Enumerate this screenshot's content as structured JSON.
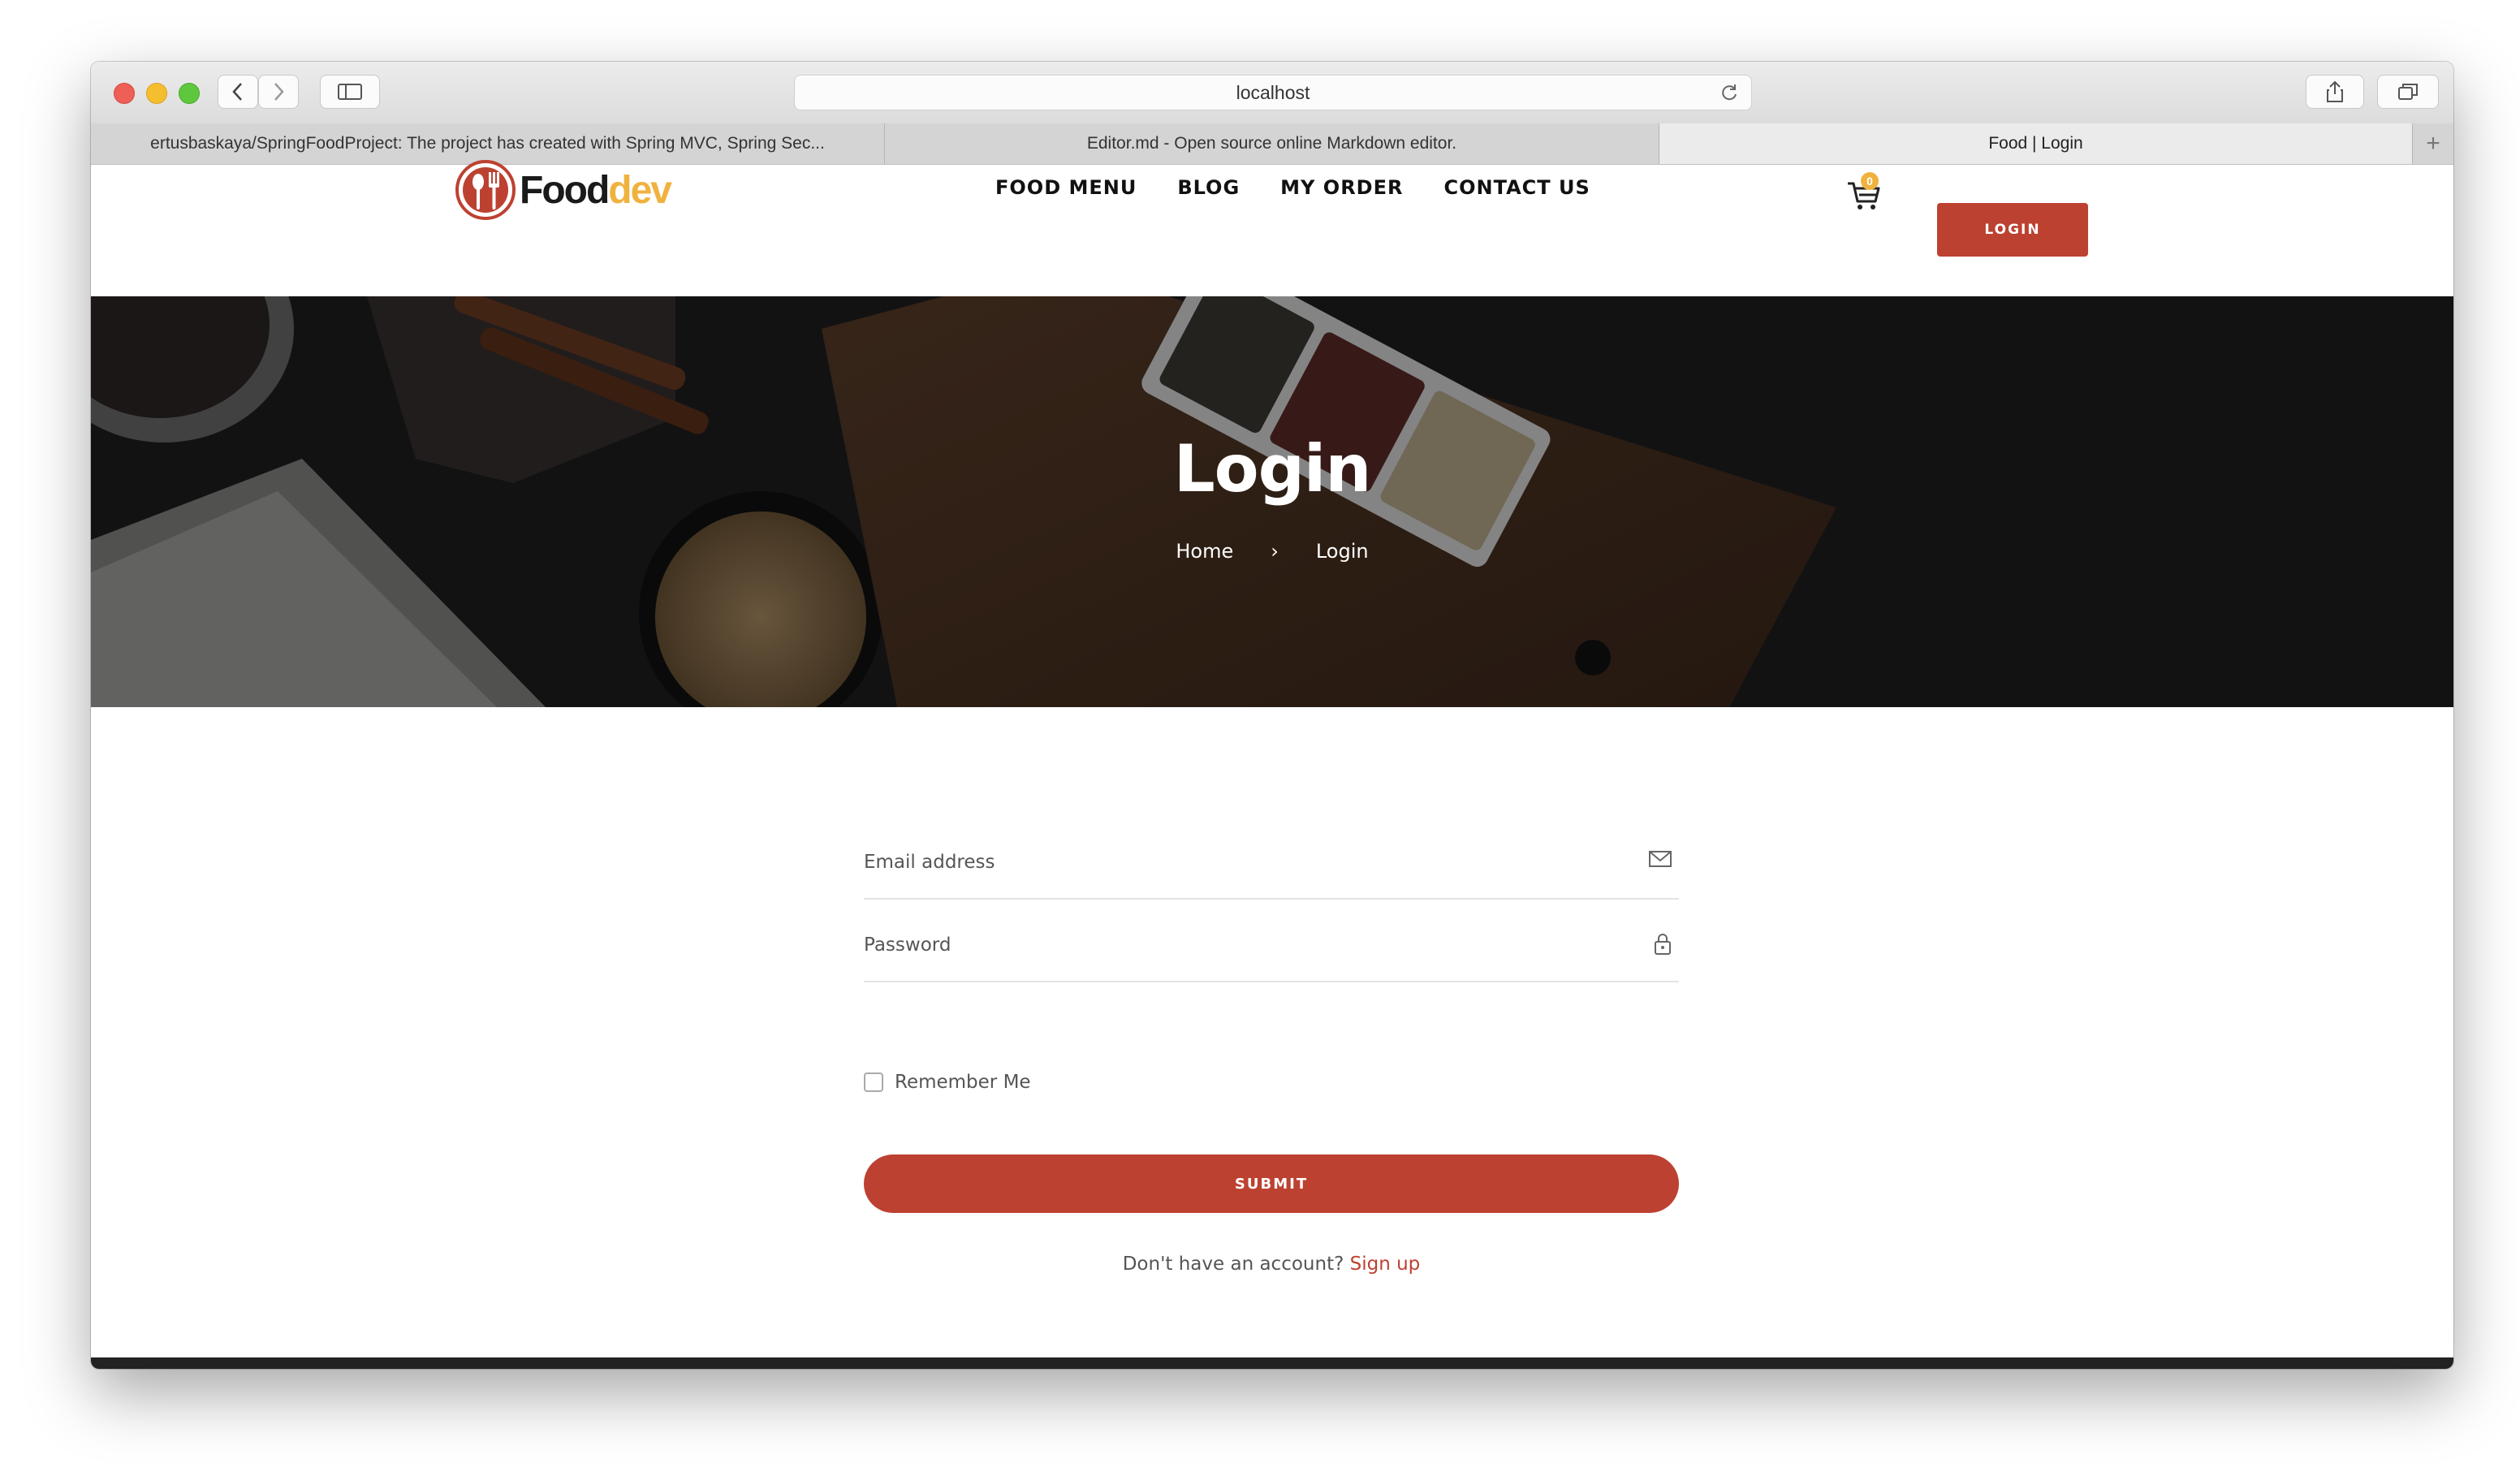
{
  "browser": {
    "url": "localhost",
    "tabs": [
      {
        "label": "ertusbaskaya/SpringFoodProject: The project has created with Spring MVC, Spring Sec...",
        "active": false
      },
      {
        "label": "Editor.md - Open source online Markdown editor.",
        "active": false
      },
      {
        "label": "Food | Login",
        "active": true
      }
    ],
    "new_tab": "+"
  },
  "header": {
    "logo_food": "Food",
    "logo_dev": "dev",
    "nav": [
      "FOOD MENU",
      "BLOG",
      "MY ORDER",
      "CONTACT US"
    ],
    "cart_count": "0",
    "login_label": "LOGIN"
  },
  "hero": {
    "title": "Login",
    "breadcrumb": {
      "home": "Home",
      "separator": "›",
      "current": "Login"
    }
  },
  "form": {
    "email_placeholder": "Email address",
    "password_placeholder": "Password",
    "remember_label": "Remember Me",
    "submit_label": "SUBMIT",
    "signup_prompt": "Don't have an account?",
    "signup_link": "Sign up"
  },
  "colors": {
    "accent": "#bd4131",
    "logo_secondary": "#f0b23f"
  }
}
